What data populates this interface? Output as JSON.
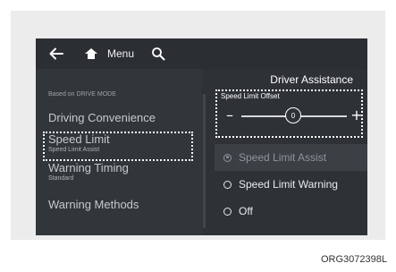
{
  "topbar": {
    "back_icon": "arrow-left-icon",
    "home_icon": "home-icon",
    "menu_label": "Menu",
    "search_icon": "search-icon"
  },
  "left_panel": {
    "caption": "Based on DRIVE MODE",
    "items": [
      {
        "label": "Driving Convenience",
        "sub": ""
      },
      {
        "label": "Speed Limit",
        "sub": "Speed Limit Assist"
      },
      {
        "label": "Warning Timing",
        "sub": "Standard"
      },
      {
        "label": "Warning Methods",
        "sub": ""
      }
    ]
  },
  "right_panel": {
    "title": "Driver Assistance",
    "offset": {
      "label": "Speed Limit Offset",
      "minus": "–",
      "plus": "+",
      "value": "0"
    },
    "options": [
      {
        "label": "Speed Limit Assist",
        "selected": true
      },
      {
        "label": "Speed Limit Warning",
        "selected": false
      },
      {
        "label": "Off",
        "selected": false
      }
    ]
  },
  "figure_code": "ORG3072398L",
  "colors": {
    "screen_bg": "#2e3236",
    "highlight": "#ffffff",
    "frame_bg": "#ececec"
  }
}
